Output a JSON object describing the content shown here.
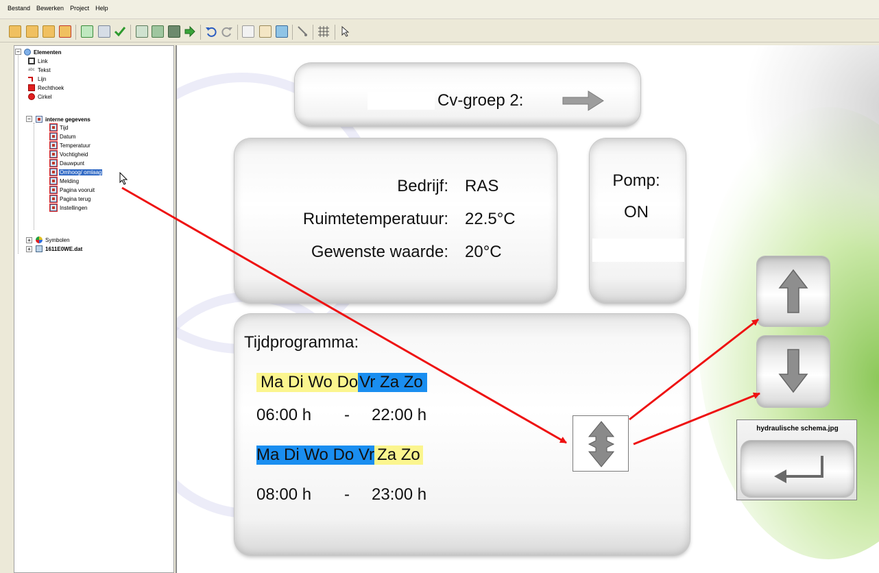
{
  "menu": [
    "Bestand",
    "Bewerken",
    "Project",
    "Help"
  ],
  "toolbar": {
    "icons": [
      "open-folder-icon",
      "open-project-icon",
      "save-icon",
      "close-icon",
      "compile-icon",
      "dat-icon",
      "check-icon",
      "page-icon",
      "import-icon",
      "export-icon",
      "next-icon",
      "undo-icon",
      "redo-icon",
      "copy-icon",
      "paste-icon",
      "image-icon",
      "pointer-icon",
      "grid-icon",
      "cursor-icon"
    ]
  },
  "tree": {
    "root": "Elementen",
    "items": [
      "Link",
      "Tekst",
      "Lijn",
      "Rechthoek",
      "Cirkel"
    ],
    "icon_labels": {
      "text_icon": "abc"
    },
    "group": "interne gegevens",
    "group_items": [
      "Tijd",
      "Datum",
      "Temperatuur",
      "Vochtigheid",
      "Dauwpunt",
      "Omhoog/ omlaag",
      "Melding",
      "Pagina vooruit",
      "Pagina terug",
      "Instellingen"
    ],
    "selected": "Omhoog/ omlaag",
    "tail": [
      "Symbolen",
      "1611E0WE.dat"
    ]
  },
  "canvas": {
    "header_title": "Cv-groep 2:",
    "status_labels": [
      "Bedrijf:",
      "Ruimtetemperatuur:",
      "Gewenste waarde:"
    ],
    "status_values": [
      "RAS",
      "22.5°C",
      "20°C"
    ],
    "pump_label": "Pomp:",
    "pump_value": "ON",
    "schedule_title": "Tijdprogramma:",
    "schedule1_days_on": "Ma Di Wo Do",
    "schedule1_days_off": "Vr Za Zo",
    "schedule1_start": "06:00 h",
    "schedule1_sep": "-",
    "schedule1_end": "22:00 h",
    "schedule2_days_on": "Ma Di Wo Do Vr",
    "schedule2_days_off": "Za Zo",
    "schedule2_start": "08:00 h",
    "schedule2_sep": "-",
    "schedule2_end": "23:00 h",
    "hydraulic_label": "hydraulische schema.jpg"
  },
  "colors": {
    "selection": "#316ac5",
    "day_yellow": "#fbf58e",
    "day_blue": "#1a8ef0",
    "annotation_arrow": "#ee1111"
  }
}
